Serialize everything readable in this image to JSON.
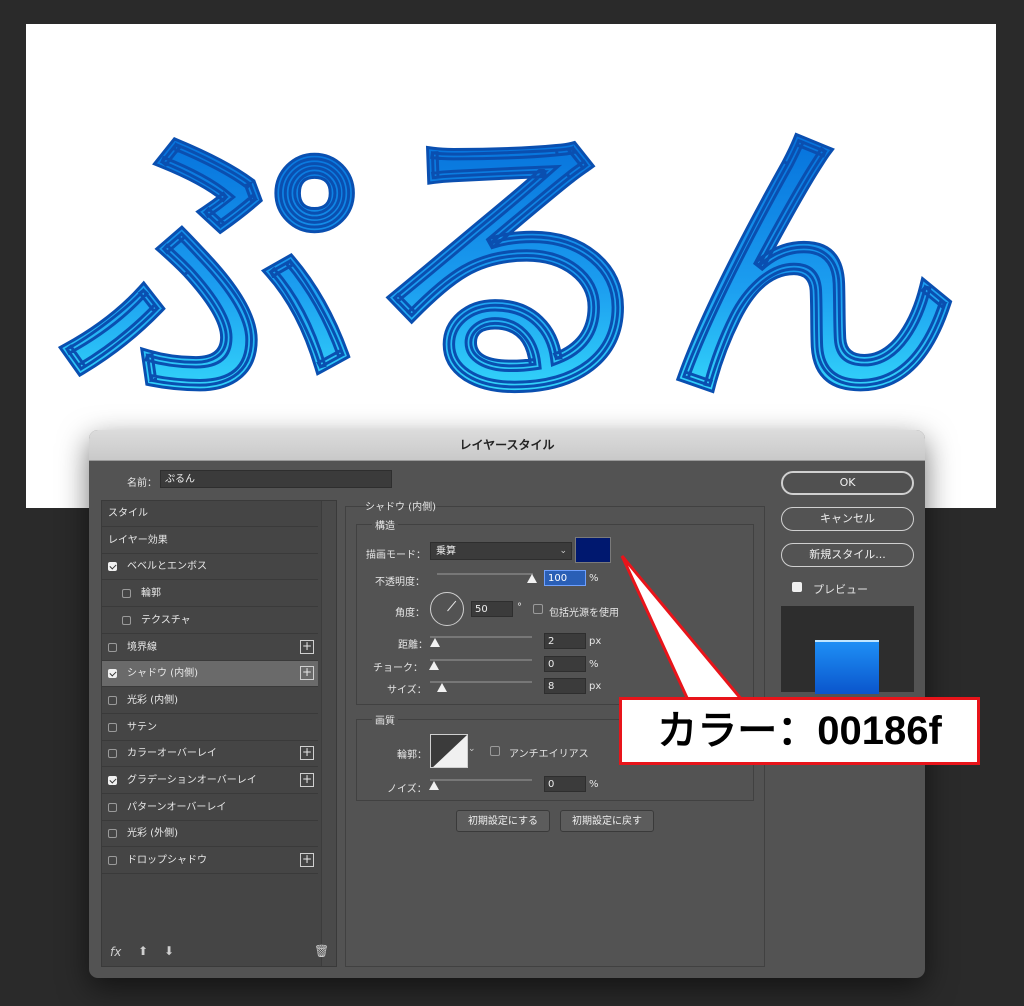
{
  "canvas": {
    "artwork_text": "ぷるん",
    "text_gradient": [
      "#0068d8",
      "#38eaff"
    ]
  },
  "dialog": {
    "title": "レイヤースタイル",
    "name_label": "名前：",
    "name_value": "ぷるん",
    "styles_header": "スタイル",
    "layer_effects": "レイヤー効果",
    "effects": [
      {
        "label": "ベベルとエンボス",
        "checked": true,
        "sub": false,
        "plus": false
      },
      {
        "label": "輪郭",
        "checked": false,
        "sub": true,
        "plus": false
      },
      {
        "label": "テクスチャ",
        "checked": false,
        "sub": true,
        "plus": false
      },
      {
        "label": "境界線",
        "checked": false,
        "sub": false,
        "plus": true
      },
      {
        "label": "シャドウ (内側)",
        "checked": true,
        "sub": false,
        "plus": true,
        "selected": true
      },
      {
        "label": "光彩 (内側)",
        "checked": false,
        "sub": false,
        "plus": false
      },
      {
        "label": "サテン",
        "checked": false,
        "sub": false,
        "plus": false
      },
      {
        "label": "カラーオーバーレイ",
        "checked": false,
        "sub": false,
        "plus": true
      },
      {
        "label": "グラデーションオーバーレイ",
        "checked": true,
        "sub": false,
        "plus": true
      },
      {
        "label": "パターンオーバーレイ",
        "checked": false,
        "sub": false,
        "plus": false
      },
      {
        "label": "光彩 (外側)",
        "checked": false,
        "sub": false,
        "plus": false
      },
      {
        "label": "ドロップシャドウ",
        "checked": false,
        "sub": false,
        "plus": true
      }
    ],
    "footer_icons": {
      "fx": "fx",
      "up": "up-arrow-icon",
      "down": "down-arrow-icon",
      "trash": "trash-icon"
    },
    "section_title": "シャドウ (内側)",
    "structure": {
      "title": "構造",
      "blend_mode_label": "描画モード：",
      "blend_mode_value": "乗算",
      "color": "#00186f",
      "opacity_label": "不透明度：",
      "opacity_value": "100",
      "opacity_unit": "%",
      "angle_label": "角度：",
      "angle_value": "50",
      "angle_unit": "°",
      "global_light_label": "包括光源を使用",
      "global_light_checked": false,
      "distance_label": "距離：",
      "distance_value": "2",
      "distance_unit": "px",
      "choke_label": "チョーク：",
      "choke_value": "0",
      "choke_unit": "%",
      "size_label": "サイズ：",
      "size_value": "8",
      "size_unit": "px"
    },
    "quality": {
      "title": "画質",
      "contour_label": "輪郭：",
      "antialias_label": "アンチエイリアス",
      "antialias_checked": false,
      "noise_label": "ノイズ：",
      "noise_value": "0",
      "noise_unit": "%"
    },
    "make_default": "初期設定にする",
    "reset_default": "初期設定に戻す",
    "ok": "OK",
    "cancel": "キャンセル",
    "new_style": "新規スタイル...",
    "preview_label": "プレビュー",
    "preview_checked": true
  },
  "annotation": {
    "callout_text": "カラー：00186f",
    "border_color": "#e8141a"
  }
}
